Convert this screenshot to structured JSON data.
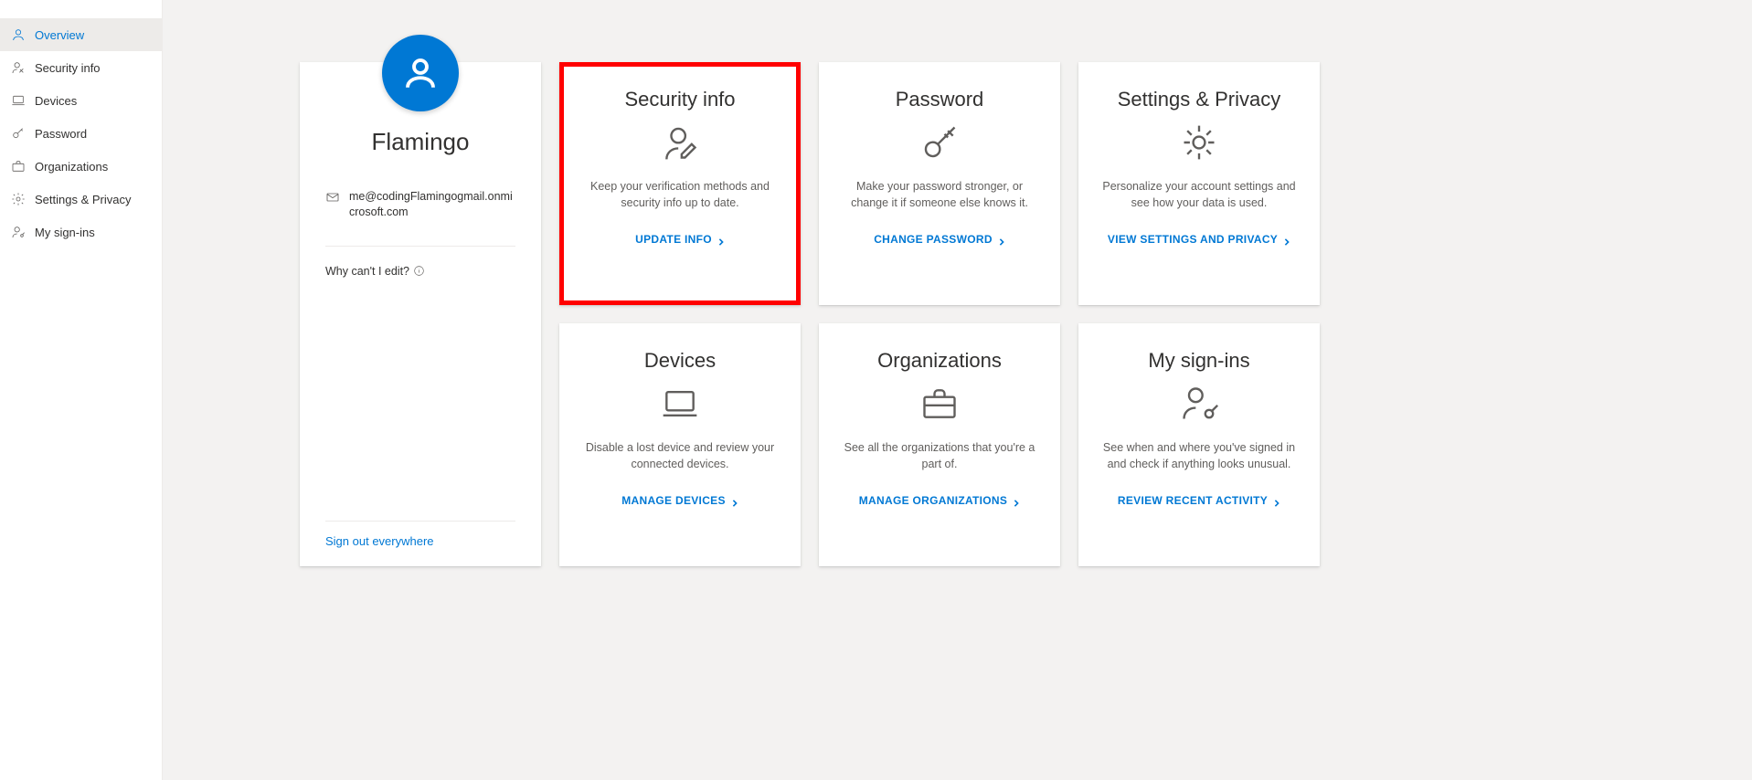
{
  "sidebar": {
    "items": [
      {
        "label": "Overview"
      },
      {
        "label": "Security info"
      },
      {
        "label": "Devices"
      },
      {
        "label": "Password"
      },
      {
        "label": "Organizations"
      },
      {
        "label": "Settings & Privacy"
      },
      {
        "label": "My sign-ins"
      }
    ]
  },
  "profile": {
    "display_name": "Flamingo",
    "email": "me@codingFlamingogmail.onmicrosoft.com",
    "why_edit": "Why can't I edit?",
    "signout": "Sign out everywhere"
  },
  "cards": {
    "security": {
      "title": "Security info",
      "desc": "Keep your verification methods and security info up to date.",
      "action": "UPDATE INFO"
    },
    "password": {
      "title": "Password",
      "desc": "Make your password stronger, or change it if someone else knows it.",
      "action": "CHANGE PASSWORD"
    },
    "settings": {
      "title": "Settings & Privacy",
      "desc": "Personalize your account settings and see how your data is used.",
      "action": "VIEW SETTINGS AND PRIVACY"
    },
    "devices": {
      "title": "Devices",
      "desc": "Disable a lost device and review your connected devices.",
      "action": "MANAGE DEVICES"
    },
    "organizations": {
      "title": "Organizations",
      "desc": "See all the organizations that you're a part of.",
      "action": "MANAGE ORGANIZATIONS"
    },
    "signins": {
      "title": "My sign-ins",
      "desc": "See when and where you've signed in and check if anything looks unusual.",
      "action": "REVIEW RECENT ACTIVITY"
    }
  }
}
